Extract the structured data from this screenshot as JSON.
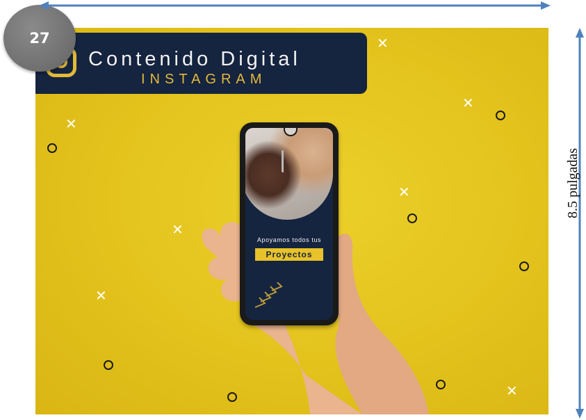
{
  "page": {
    "page_number": "27",
    "height_label": "8.5 pulgadas"
  },
  "banner": {
    "title": "Contenido Digital",
    "subtitle": "INSTAGRAM",
    "logo_icon": "instagram-icon"
  },
  "phone_screen": {
    "tagline": "Apoyamos todos tus",
    "highlight": "Proyectos",
    "decor_icon": "chevron-arrows-icon"
  },
  "colors": {
    "background_yellow": "#e3c21c",
    "navy": "#15243f",
    "gold": "#e3b93b",
    "arrow_blue": "#4f81bd",
    "badge_gray": "#6f6f6f"
  }
}
